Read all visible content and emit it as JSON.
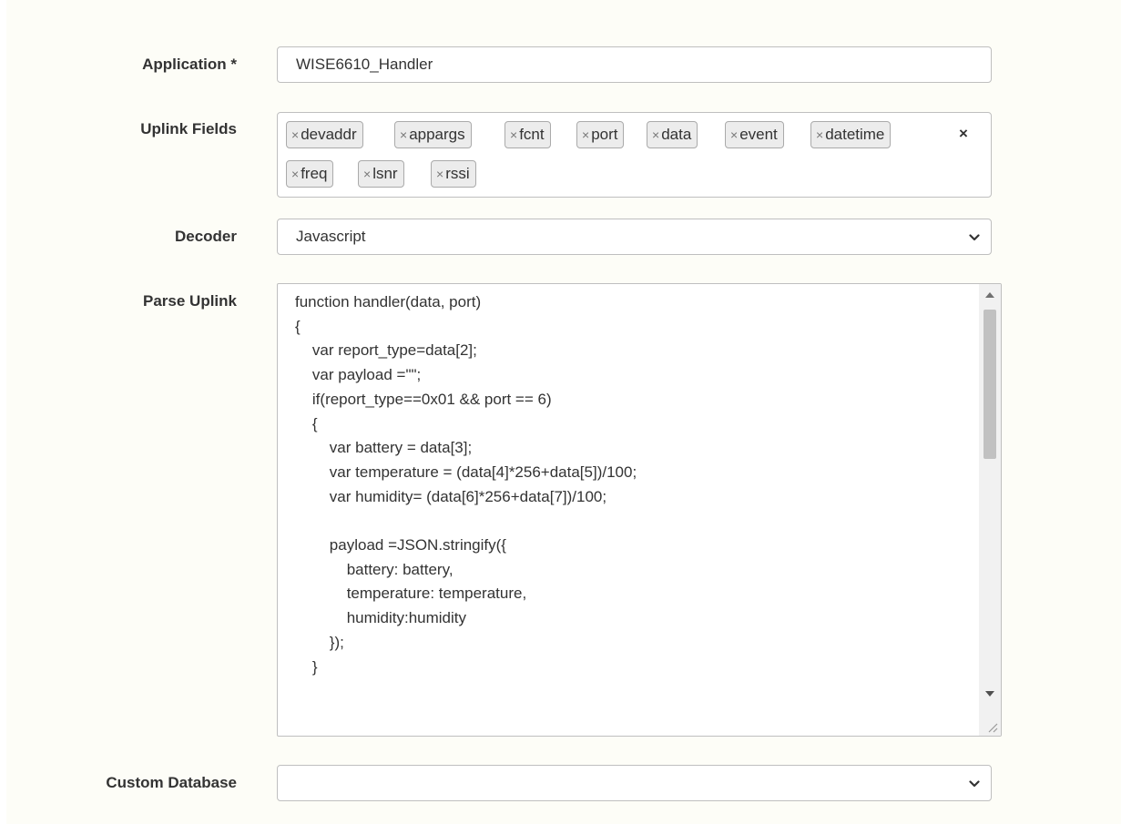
{
  "form": {
    "application": {
      "label": "Application *",
      "value": "WISE6610_Handler"
    },
    "uplink_fields": {
      "label": "Uplink Fields",
      "tags": [
        "devaddr",
        "appargs",
        "fcnt",
        "port",
        "data",
        "event",
        "datetime",
        "freq",
        "lsnr",
        "rssi"
      ],
      "tag_remove_glyph": "×",
      "clear_glyph": "×"
    },
    "decoder": {
      "label": "Decoder",
      "selected": "Javascript"
    },
    "parse_uplink": {
      "label": "Parse Uplink",
      "code": "function handler(data, port)\n{\n\tvar report_type=data[2];\n\tvar payload =\"\";\n\tif(report_type==0x01 && port == 6)\n\t{\n\t\tvar battery = data[3];\n\t\tvar temperature = (data[4]*256+data[5])/100;\n\t\tvar humidity= (data[6]*256+data[7])/100;\n\n\t\tpayload =JSON.stringify({\n\t\t\tbattery: battery,\n\t\t\ttemperature: temperature,\n\t\t\thumidity:humidity\n\t\t});\n\t}"
    },
    "custom_database": {
      "label": "Custom Database",
      "selected": ""
    }
  },
  "icons": {
    "select_arrow": "chevron-down-icon",
    "scroll_up": "scroll-up-arrow-icon",
    "scroll_down": "scroll-down-arrow-icon",
    "resize": "resize-grip-icon"
  }
}
